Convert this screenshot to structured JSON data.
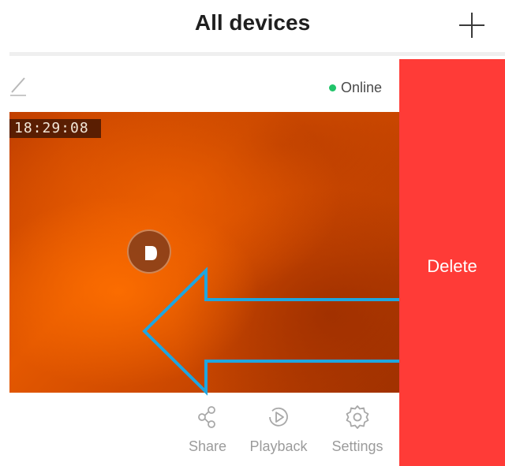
{
  "header": {
    "title": "All devices",
    "add_icon": "plus-icon"
  },
  "device": {
    "edit_icon": "pencil-icon",
    "status": "Online",
    "status_color": "#21c46a",
    "timestamp": "18:29:08",
    "play_icon": "play-icon"
  },
  "actions": [
    {
      "label": "Share",
      "icon": "share-icon"
    },
    {
      "label": "Playback",
      "icon": "playback-icon"
    },
    {
      "label": "Settings",
      "icon": "settings-gear-icon"
    }
  ],
  "delete": {
    "label": "Delete",
    "color": "#ff3b37"
  },
  "overlay": {
    "swipe_arrow_icon": "left-arrow-icon",
    "arrow_color": "#1fa6e0"
  }
}
